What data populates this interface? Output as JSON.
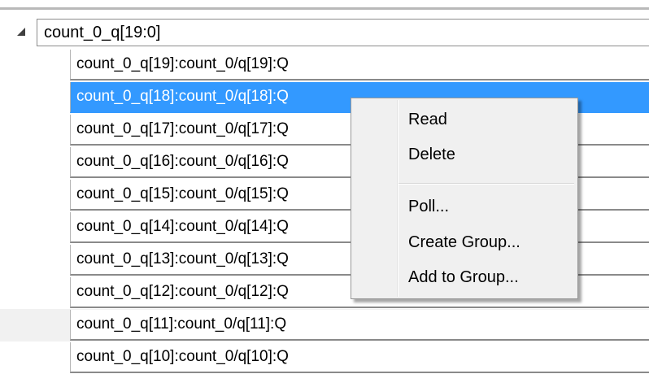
{
  "tree": {
    "parent": {
      "label": "count_0_q[19:0]",
      "expander_icon": "expanded-triangle-icon"
    },
    "children": [
      {
        "label": "count_0_q[19]:count_0/q[19]:Q",
        "selected": false
      },
      {
        "label": "count_0_q[18]:count_0/q[18]:Q",
        "selected": true
      },
      {
        "label": "count_0_q[17]:count_0/q[17]:Q",
        "selected": false
      },
      {
        "label": "count_0_q[16]:count_0/q[16]:Q",
        "selected": false
      },
      {
        "label": "count_0_q[15]:count_0/q[15]:Q",
        "selected": false
      },
      {
        "label": "count_0_q[14]:count_0/q[14]:Q",
        "selected": false
      },
      {
        "label": "count_0_q[13]:count_0/q[13]:Q",
        "selected": false
      },
      {
        "label": "count_0_q[12]:count_0/q[12]:Q",
        "selected": false
      },
      {
        "label": "count_0_q[11]:count_0/q[11]:Q",
        "selected": false
      },
      {
        "label": "count_0_q[10]:count_0/q[10]:Q",
        "selected": false
      }
    ]
  },
  "context_menu": {
    "items": [
      {
        "label": "Read"
      },
      {
        "label": "Delete"
      },
      {
        "label": "Poll..."
      },
      {
        "label": "Create Group..."
      },
      {
        "label": "Add to Group..."
      }
    ]
  },
  "colors": {
    "selection": "#3399ff",
    "row_alt": "#f1f1f1",
    "menu_background": "#f0f0f0"
  }
}
